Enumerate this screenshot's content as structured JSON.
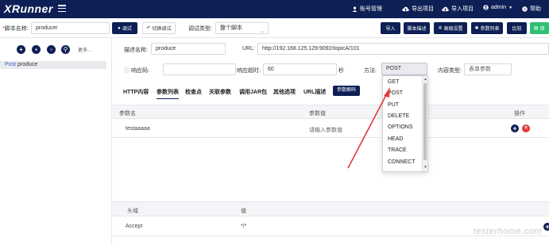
{
  "nav": {
    "logo": "XRunner",
    "items": [
      {
        "label": "账号管理",
        "icon": "user-icon"
      },
      {
        "label": "导出项目",
        "icon": "cloud-upload-icon"
      },
      {
        "label": "导入项目",
        "icon": "cloud-download-icon"
      },
      {
        "label": "admin",
        "icon": "user-circle-icon"
      },
      {
        "label": "帮助",
        "icon": "help-icon"
      }
    ]
  },
  "toolbar": {
    "script_name_label": "脚本名称:",
    "script_name_value": "producer",
    "debug_button": "调试",
    "switch_debug_button": "切换调试",
    "debug_type_label": "调试类型:",
    "debug_type_value": "整个脚本",
    "right_buttons": [
      "导入",
      "脚本描述",
      "高级设置",
      "参数列表",
      "比较"
    ],
    "green_button": "保"
  },
  "left_panel": {
    "more_label": "更多...",
    "tree_items": [
      {
        "method": "Post",
        "name": "produce"
      }
    ]
  },
  "form": {
    "desc_label": "描述名称:",
    "desc_value": "produce",
    "url_label": "URL:",
    "url_value": "http://192.168.125.129:9092/topicA/101",
    "response_code_label": "响应码:",
    "timeout_label": "响应超时:",
    "timeout_value": "60",
    "timeout_unit": "秒",
    "method_label": "方法:",
    "method_value": "POST",
    "content_type_label": "内容类型:",
    "content_type_value": "表单参数"
  },
  "tabs": [
    "HTTP内容",
    "参数列表",
    "检查点",
    "关联参数",
    "调用JAR包",
    "其他选项",
    "URL描述"
  ],
  "active_tab": "参数列表",
  "tab_button": "参数解码",
  "params_table": {
    "headers": [
      "参数名",
      "参数值",
      "操作"
    ],
    "rows": [
      {
        "name": "testaaaaa",
        "value": "请输入参数值"
      }
    ]
  },
  "headers_table": {
    "headers": [
      "头域",
      "值"
    ],
    "rows": [
      {
        "name": "Accept",
        "value": "*/*"
      }
    ]
  },
  "method_dropdown": {
    "options": [
      "GET",
      "POST",
      "PUT",
      "DELETE",
      "OPTIONS",
      "HEAD",
      "TRACE",
      "CONNECT"
    ],
    "selected": "POST"
  },
  "watermark": "testerhome.com",
  "colors": {
    "nav_bg": "#0d1f55",
    "accent": "#0d1f55",
    "danger": "#e23b3b",
    "success": "#2fbf71",
    "arrow": "#e23b3b"
  }
}
